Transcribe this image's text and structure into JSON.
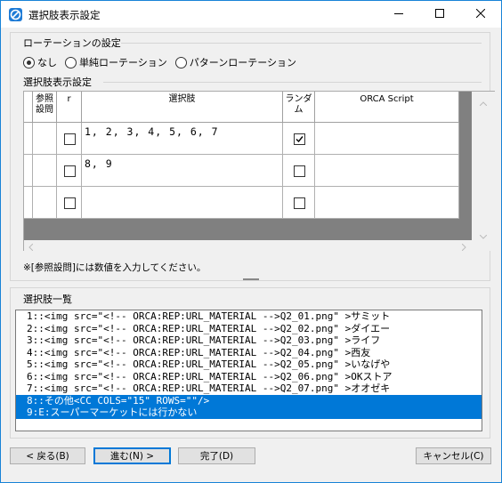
{
  "window": {
    "title": "選択肢表示設定",
    "controls": {
      "minimize": "minimize-icon",
      "maximize": "maximize-icon",
      "close": "close-icon"
    }
  },
  "rotation": {
    "group_title": "ローテーションの設定",
    "options": [
      {
        "label": "なし",
        "selected": true
      },
      {
        "label": "単純ローテーション",
        "selected": false
      },
      {
        "label": "パターンローテーション",
        "selected": false
      }
    ]
  },
  "choice_display": {
    "group_title": "選択肢表示設定",
    "columns": [
      "参照\n設問",
      "r",
      "選択肢",
      "ランダム",
      "ORCA Script"
    ],
    "rows": [
      {
        "ref": "",
        "r": false,
        "choice": "1, 2, 3, 4, 5, 6, 7",
        "random": true,
        "script": ""
      },
      {
        "ref": "",
        "r": false,
        "choice": "8, 9",
        "random": false,
        "script": ""
      },
      {
        "ref": "",
        "r": false,
        "choice": "",
        "random": false,
        "script": ""
      }
    ],
    "note": "※[参照設問]には数値を入力してください。"
  },
  "choice_list": {
    "group_title": "選択肢一覧",
    "items": [
      "1::<img src=\"<!-- ORCA:REP:URL_MATERIAL -->Q2_01.png\" >サミット",
      "2::<img src=\"<!-- ORCA:REP:URL_MATERIAL -->Q2_02.png\" >ダイエー",
      "3::<img src=\"<!-- ORCA:REP:URL_MATERIAL -->Q2_03.png\" >ライフ",
      "4::<img src=\"<!-- ORCA:REP:URL_MATERIAL -->Q2_04.png\" >西友",
      "5::<img src=\"<!-- ORCA:REP:URL_MATERIAL -->Q2_05.png\" >いなげや",
      "6::<img src=\"<!-- ORCA:REP:URL_MATERIAL -->Q2_06.png\" >OKストア",
      "7::<img src=\"<!-- ORCA:REP:URL_MATERIAL -->Q2_07.png\" >オオゼキ",
      "8::その他<CC COLS=\"15\" ROWS=\"\"/>",
      "9:E:スーパーマーケットには行かない"
    ],
    "selected_indices": [
      7,
      8
    ]
  },
  "buttons": {
    "back": "< 戻る(B)",
    "next": "進む(N) >",
    "finish": "完了(D)",
    "cancel": "キャンセル(C)"
  }
}
